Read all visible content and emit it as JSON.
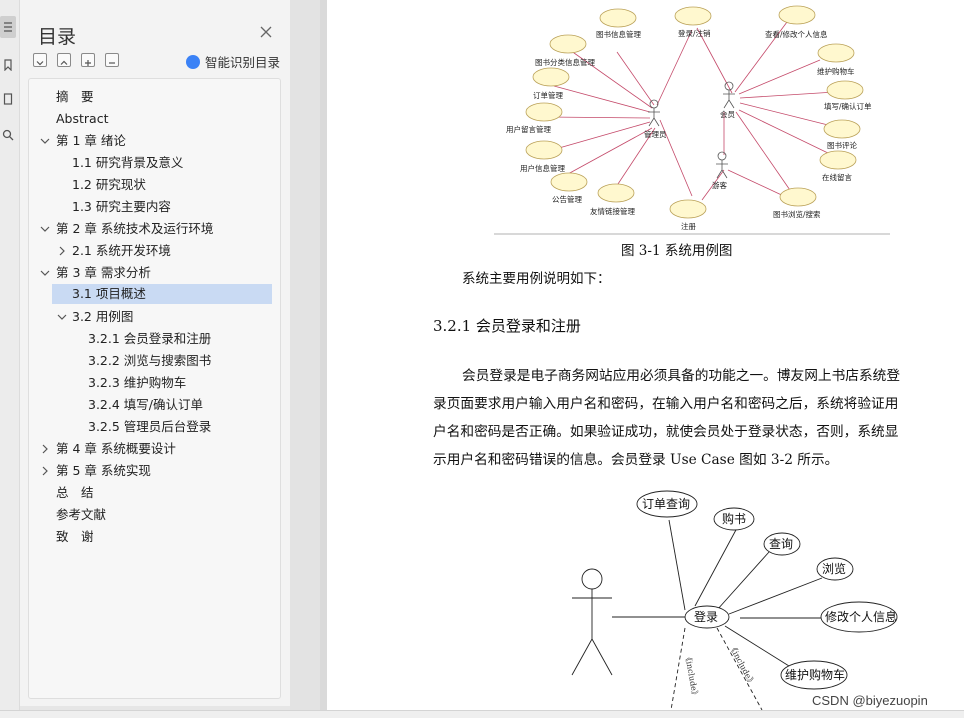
{
  "toc": {
    "title": "目录",
    "smart_label": "智能识别目录",
    "items": [
      {
        "label": "摘　要"
      },
      {
        "label": "Abstract"
      },
      {
        "label": "第 1 章  绪论"
      },
      {
        "label": "1.1  研究背景及意义"
      },
      {
        "label": "1.2  研究现状"
      },
      {
        "label": "1.3  研究主要内容"
      },
      {
        "label": "第 2 章  系统技术及运行环境"
      },
      {
        "label": "2.1 系统开发环境"
      },
      {
        "label": "第 3 章  需求分析"
      },
      {
        "label": "3.1 项目概述"
      },
      {
        "label": "3.2  用例图"
      },
      {
        "label": "3.2.1 会员登录和注册"
      },
      {
        "label": "3.2.2 浏览与搜索图书"
      },
      {
        "label": "3.2.3 维护购物车"
      },
      {
        "label": "3.2.4 填写/确认订单"
      },
      {
        "label": "3.2.5 管理员后台登录"
      },
      {
        "label": "第 4 章  系统概要设计"
      },
      {
        "label": "第 5 章  系统实现"
      },
      {
        "label": "总　结"
      },
      {
        "label": "参考文献"
      },
      {
        "label": "致　谢"
      }
    ]
  },
  "doc": {
    "fig1_caption": "图 3-1  系统用例图",
    "intro": "系统主要用例说明如下：",
    "heading": "3.2.1 会员登录和注册",
    "para": [
      "会员登录是电子商务网站应用必须具备的功能之一。博友网上书店系统登",
      "录页面要求用户输入用户名和密码，在输入用户名和密码之后，系统将验证用",
      "户名和密码是否正确。如果验证成功，就使会员处于登录状态，否则，系统显",
      "示用户名和密码错误的信息。会员登录 Use Case 图如 3-2 所示。"
    ]
  },
  "fig1": {
    "actor_admin": "管理员",
    "actor_member": "会员",
    "actor_guest": "游客",
    "uc": [
      "图书信息管理",
      "登录/注销",
      "查看/修改个人信息",
      "图书分类信息管理",
      "维护购物车",
      "订单管理",
      "填写/确认订单",
      "用户留言管理",
      "图书评论",
      "用户信息管理",
      "在线留言",
      "公告管理",
      "友情链接管理",
      "注册",
      "图书浏览/搜索"
    ]
  },
  "fig2": {
    "center": "登录",
    "uc": [
      "订单查询",
      "购书",
      "查询",
      "浏览",
      "修改个人信息",
      "维护购物车"
    ],
    "include": "《include》"
  },
  "watermark": "CSDN @biyezuopin"
}
